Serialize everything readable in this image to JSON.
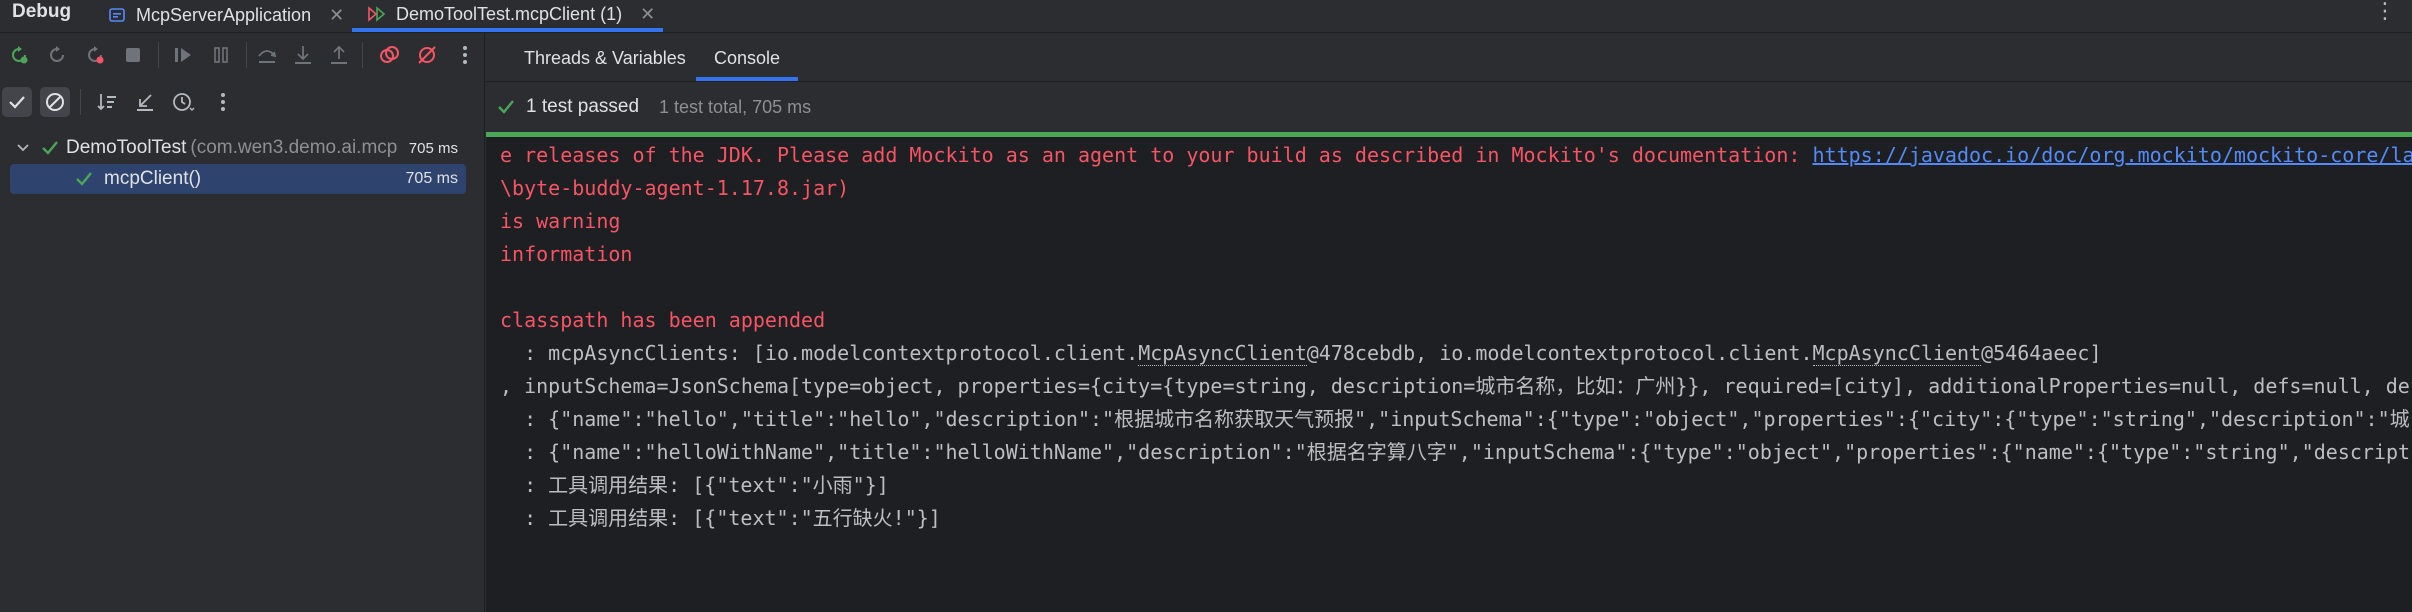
{
  "window": {
    "title": "Debug"
  },
  "run_tabs": [
    {
      "label": "McpServerApplication",
      "icon": "app-config-icon",
      "active": false
    },
    {
      "label": "DemoToolTest.mcpClient (1)",
      "icon": "test-run-icon",
      "active": true
    }
  ],
  "panel_tabs": [
    {
      "label": "Threads & Variables",
      "active": false
    },
    {
      "label": "Console",
      "active": true
    }
  ],
  "debug_toolbar": [
    "rerun-icon",
    "restart-icon",
    "rerun-failed-icon",
    "stop-icon",
    "resume-icon",
    "pause-icon",
    "step-over-icon",
    "step-into-icon",
    "step-out-icon",
    "view-breakpoints-icon",
    "mute-breakpoints-icon",
    "more-icon"
  ],
  "test_toolbar": [
    "show-passed-icon",
    "show-ignored-icon",
    "sort-icon",
    "collapse-icon",
    "history-icon",
    "more-icon"
  ],
  "status": {
    "summary": "1 test passed",
    "detail": "1 test total, 705 ms",
    "color": "#4ca658"
  },
  "tree": [
    {
      "name": "DemoToolTest",
      "package": "(com.wen3.demo.ai.mcp",
      "duration": "705 ms",
      "status": "passed",
      "expanded": true
    },
    {
      "name": "mcpClient()",
      "duration": "705 ms",
      "status": "passed",
      "selected": true
    }
  ],
  "console": {
    "l1_text": "e releases of the JDK. Please add Mockito as an agent to your build as described in Mockito's documentation: ",
    "l1_link": "https://javadoc.io/doc/org.mockito/mockito-core/la",
    "l2": "\\byte-buddy-agent-1.17.8.jar)",
    "l3": "is warning",
    "l4": "information",
    "l6": "classpath has been appended",
    "l7_a": "  : mcpAsyncClients: [io.modelcontextprotocol.client.",
    "l7_b": "McpAsyncClient",
    "l7_c": "@478cebdb, io.modelcontextprotocol.client.",
    "l7_d": "McpAsyncClient",
    "l7_e": "@5464aeec]",
    "l8": ", inputSchema=JsonSchema[type=object, properties={city={type=string, description=城市名称，比如：广州}}, required=[city], additionalProperties=null, defs=null, def",
    "l9": "  : {\"name\":\"hello\",\"title\":\"hello\",\"description\":\"根据城市名称获取天气预报\",\"inputSchema\":{\"type\":\"object\",\"properties\":{\"city\":{\"type\":\"string\",\"description\":\"城",
    "l10": "  : {\"name\":\"helloWithName\",\"title\":\"helloWithName\",\"description\":\"根据名字算八字\",\"inputSchema\":{\"type\":\"object\",\"properties\":{\"name\":{\"type\":\"string\",\"descript",
    "l11": "  : 工具调用结果: [{\"text\":\"小雨\"}]",
    "l12": "  : 工具调用结果: [{\"text\":\"五行缺火!\"}]"
  }
}
